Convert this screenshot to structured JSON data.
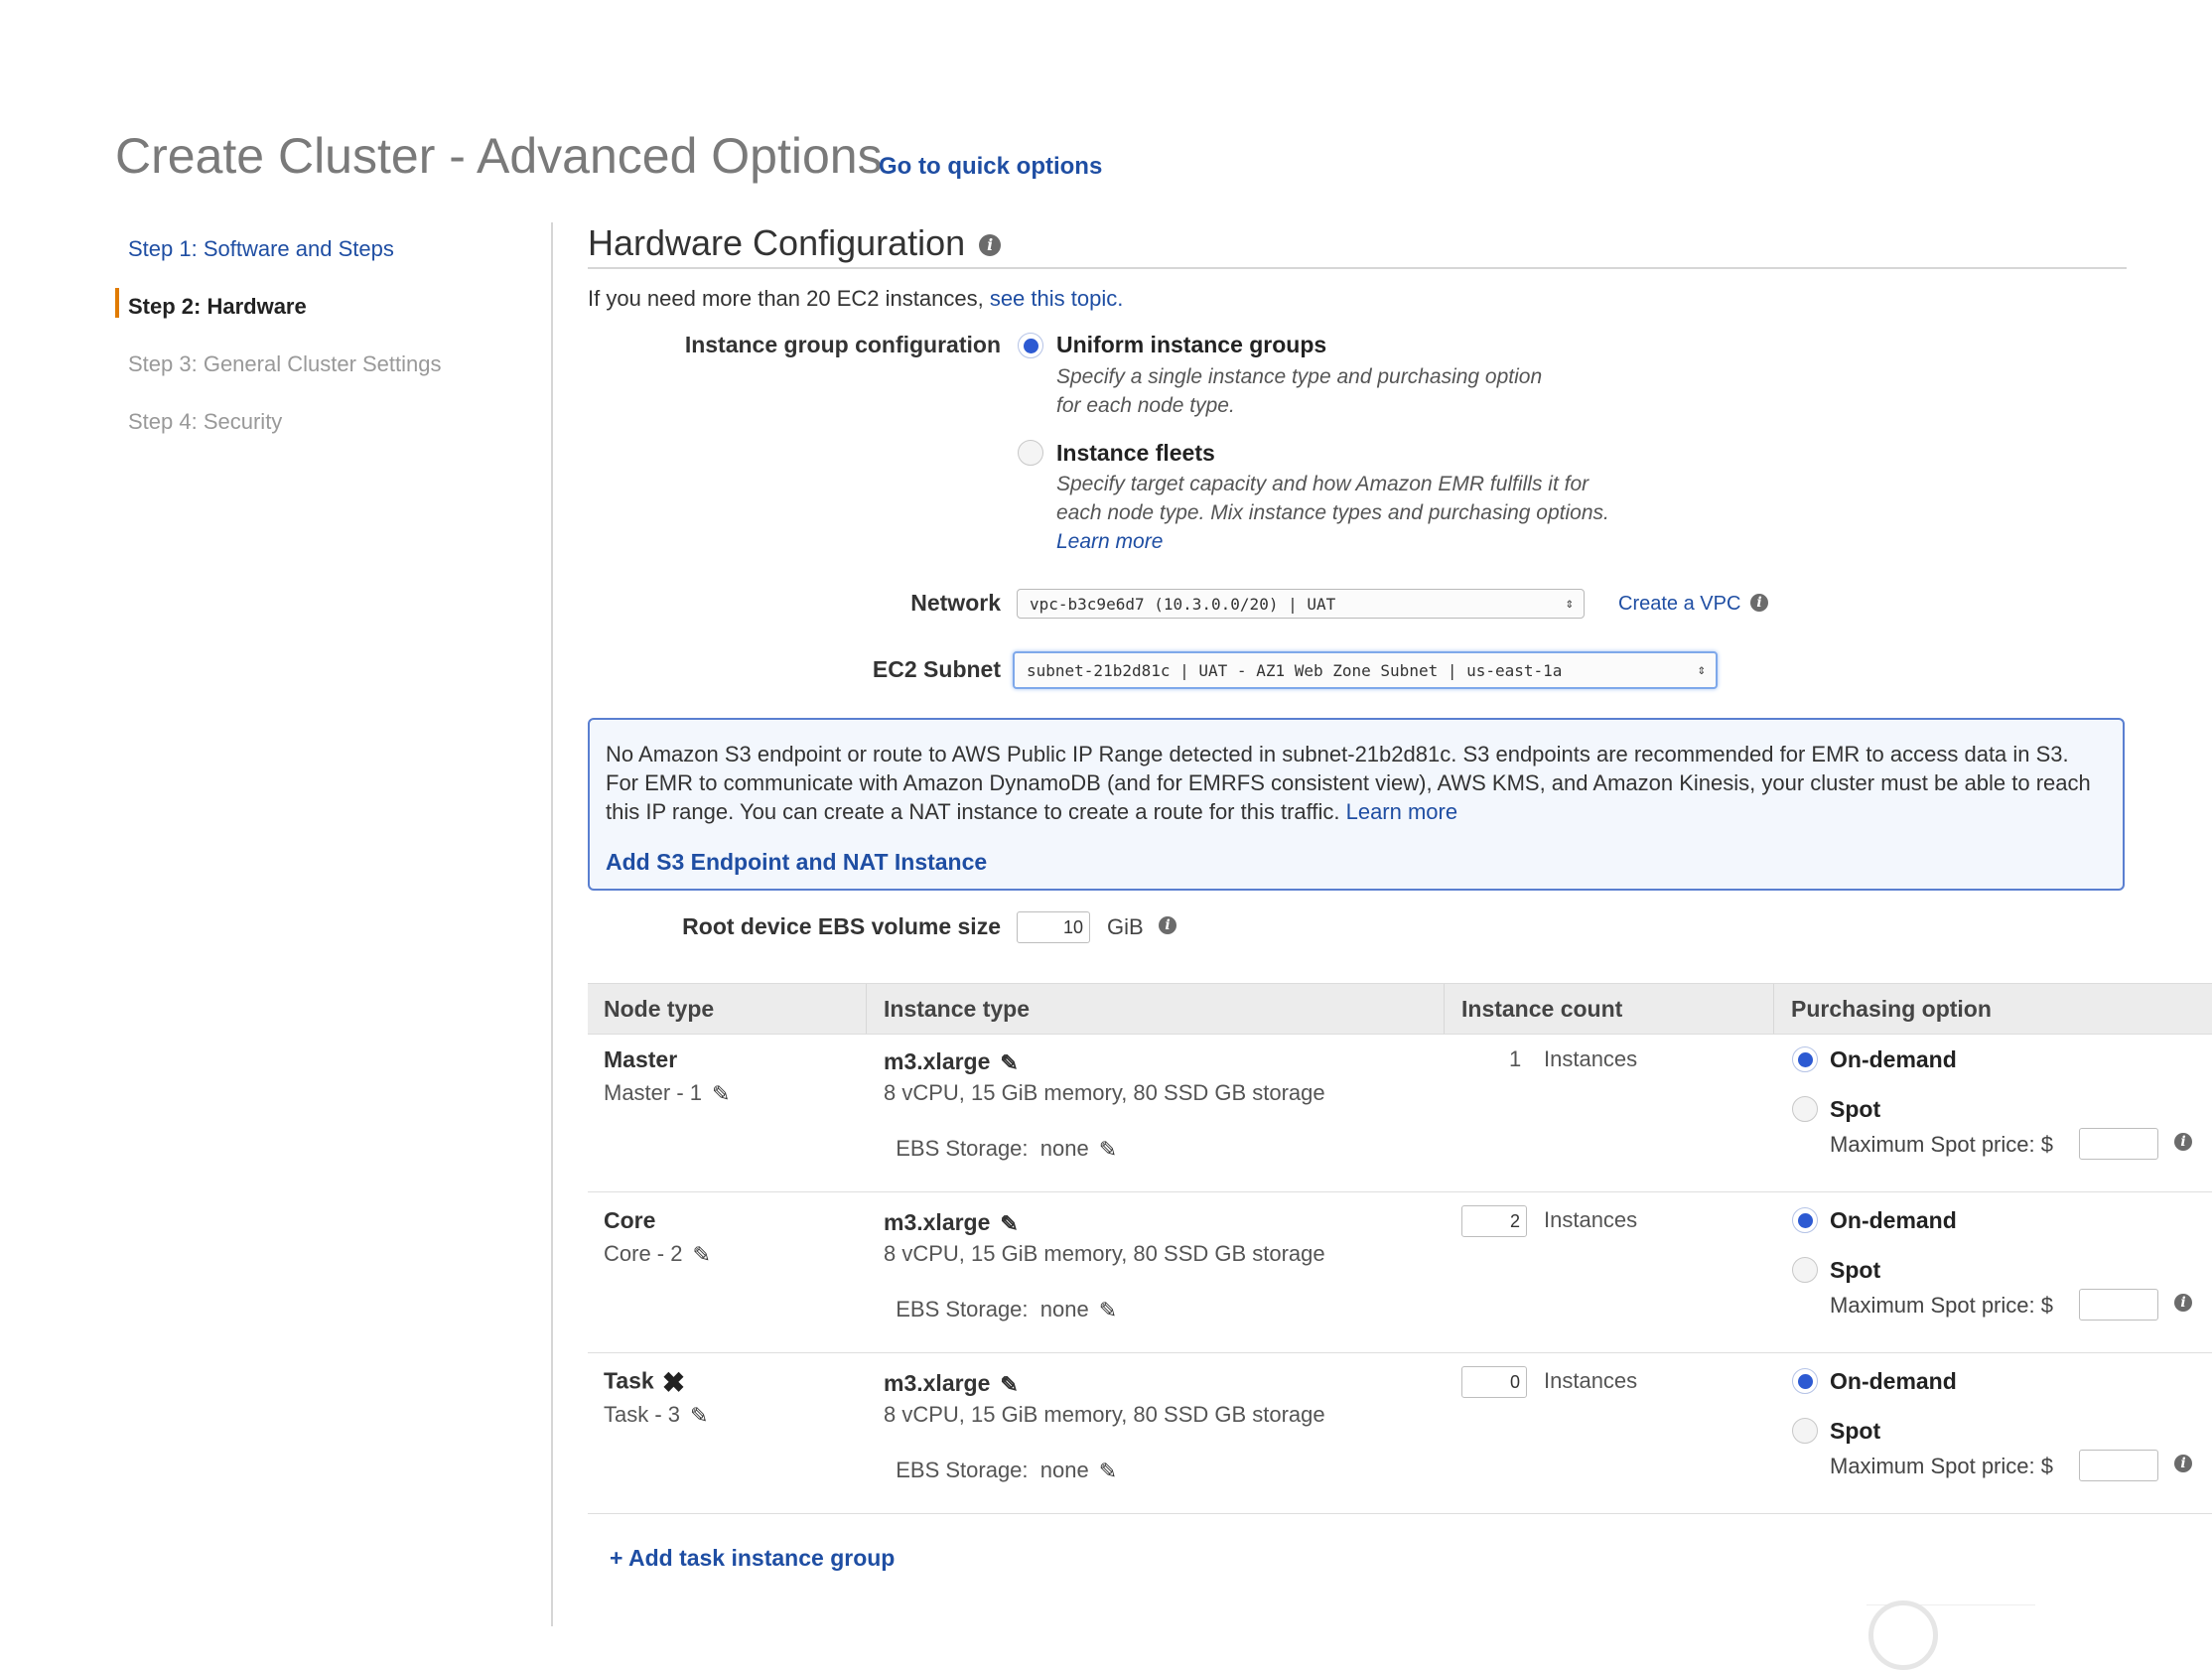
{
  "header": {
    "title": "Create Cluster - Advanced Options",
    "quick_link": "Go to quick options"
  },
  "steps": [
    {
      "label": "Step 1: Software and Steps",
      "state": "link"
    },
    {
      "label": "Step 2: Hardware",
      "state": "current"
    },
    {
      "label": "Step 3: General Cluster Settings",
      "state": "disabled"
    },
    {
      "label": "Step 4: Security",
      "state": "disabled"
    }
  ],
  "hardware": {
    "title": "Hardware Configuration",
    "intro_text": "If you need more than 20 EC2 instances,",
    "intro_link": "see this topic.",
    "instance_group_label": "Instance group configuration",
    "options": [
      {
        "title": "Uniform instance groups",
        "desc": "Specify a single instance type and purchasing option for each node type.",
        "selected": true
      },
      {
        "title": "Instance fleets",
        "desc": "Specify target capacity and how Amazon EMR fulfills it for each node type. Mix instance types and purchasing options.",
        "learn_more": "Learn more",
        "selected": false
      }
    ],
    "network_label": "Network",
    "network_value": "vpc-b3c9e6d7 (10.3.0.0/20) | UAT",
    "create_vpc": "Create a VPC",
    "subnet_label": "EC2 Subnet",
    "subnet_value": "subnet-21b2d81c | UAT - AZ1 Web Zone Subnet | us-east-1a",
    "alert_text": "No Amazon S3 endpoint or route to AWS Public IP Range detected in subnet-21b2d81c. S3 endpoints are recommended for EMR to access data in S3. For EMR to communicate with Amazon DynamoDB (and for EMRFS consistent view), AWS KMS, and Amazon Kinesis, your cluster must be able to reach this IP range. You can create a NAT instance to create a route for this traffic.",
    "alert_learn_more": "Learn more",
    "alert_action": "Add S3 Endpoint and NAT Instance",
    "root_ebs_label": "Root device EBS volume size",
    "root_ebs_value": "10",
    "root_ebs_unit": "GiB"
  },
  "table": {
    "headers": [
      "Node type",
      "Instance type",
      "Instance count",
      "Purchasing option"
    ],
    "rows": [
      {
        "node": "Master",
        "sub": "Master - 1",
        "itype": "m3.xlarge",
        "spec": "8 vCPU, 15 GiB memory, 80 SSD GB storage",
        "ebs": "EBS Storage:  none",
        "count": "1",
        "count_unit": "Instances",
        "on_demand": "On-demand",
        "spot": "Spot",
        "max_spot": "Maximum Spot price: $"
      },
      {
        "node": "Core",
        "sub": "Core - 2",
        "itype": "m3.xlarge",
        "spec": "8 vCPU, 15 GiB memory, 80 SSD GB storage",
        "ebs": "EBS Storage:  none",
        "count": "2",
        "count_unit": "Instances",
        "on_demand": "On-demand",
        "spot": "Spot",
        "max_spot": "Maximum Spot price: $"
      },
      {
        "node": "Task",
        "sub": "Task - 3",
        "itype": "m3.xlarge",
        "spec": "8 vCPU, 15 GiB memory, 80 SSD GB storage",
        "ebs": "EBS Storage:  none",
        "count": "0",
        "count_unit": "Instances",
        "on_demand": "On-demand",
        "spot": "Spot",
        "max_spot": "Maximum Spot price: $"
      }
    ],
    "add_task": "+ Add task instance group"
  },
  "icons": {
    "info": "info-icon",
    "edit": "pencil-icon",
    "remove": "x-icon",
    "select_arrow": "updown-arrow-icon"
  },
  "colors": {
    "link": "#1f4ea3",
    "step_marker": "#e07b00",
    "radio_selected": "#2d5ad2",
    "alert_border": "#5a7fd0"
  }
}
